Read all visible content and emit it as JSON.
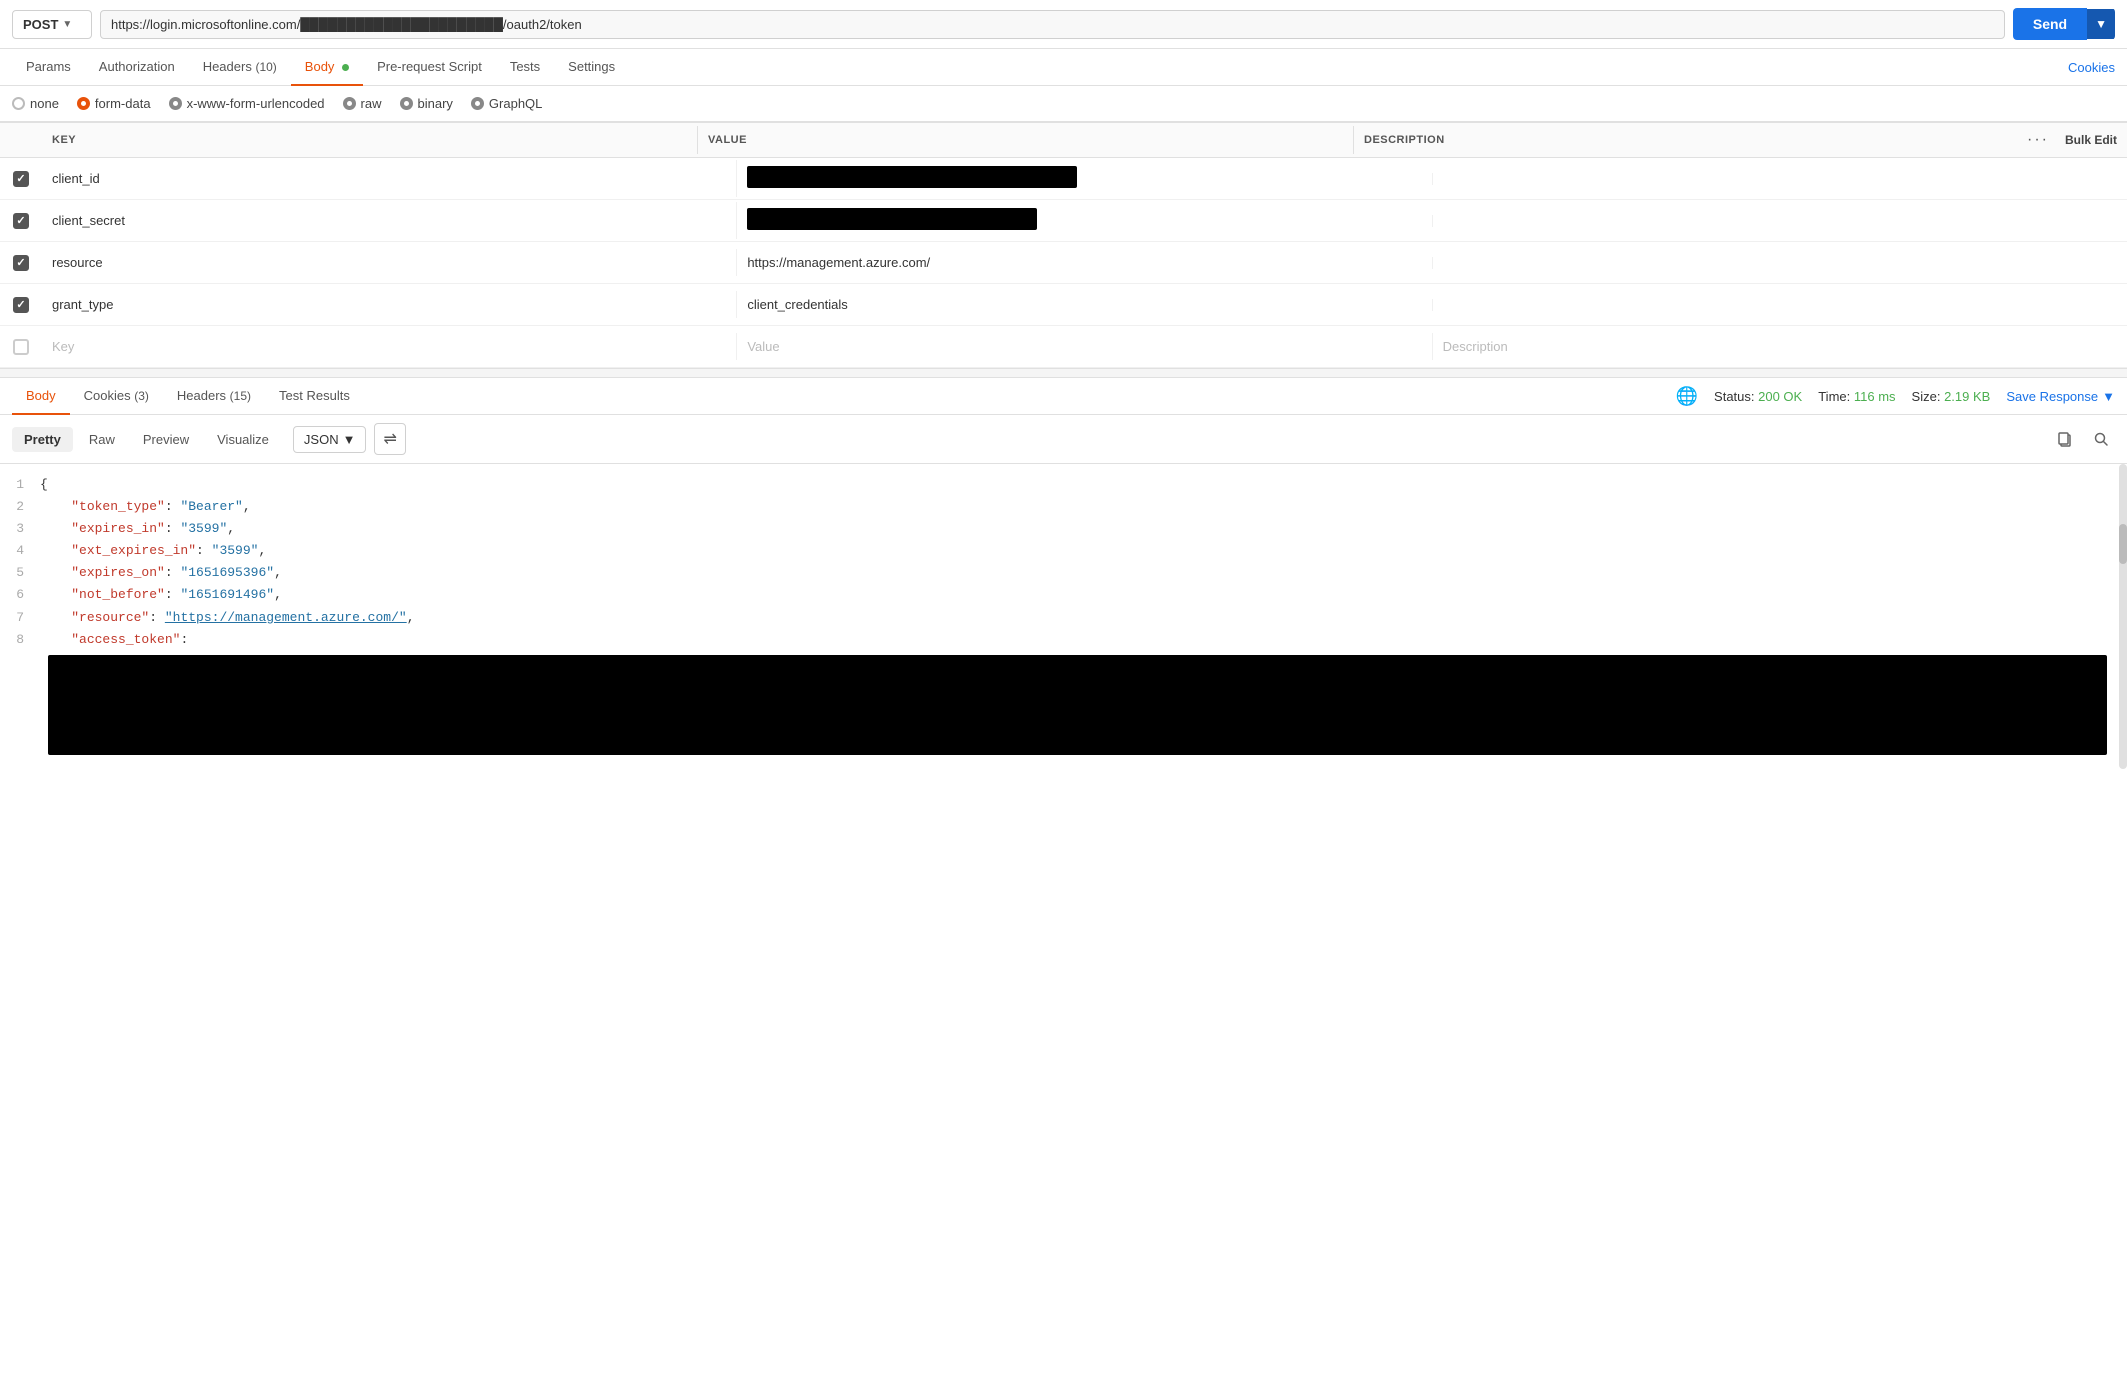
{
  "urlBar": {
    "method": "POST",
    "url": "https://login.microsoftonline.com/████████████████████████████/oauth2/token",
    "urlDisplay": "https://login.microsoftonline.com/",
    "urlRedacted": "██████████████████████████",
    "urlSuffix": "/oauth2/token",
    "sendLabel": "Send"
  },
  "tabs": {
    "items": [
      {
        "label": "Params",
        "active": false,
        "badge": null,
        "dot": false
      },
      {
        "label": "Authorization",
        "active": false,
        "badge": null,
        "dot": false
      },
      {
        "label": "Headers",
        "active": false,
        "badge": "(10)",
        "dot": false
      },
      {
        "label": "Body",
        "active": true,
        "badge": null,
        "dot": true
      },
      {
        "label": "Pre-request Script",
        "active": false,
        "badge": null,
        "dot": false
      },
      {
        "label": "Tests",
        "active": false,
        "badge": null,
        "dot": false
      },
      {
        "label": "Settings",
        "active": false,
        "badge": null,
        "dot": false
      }
    ],
    "rightLink": "Cookies"
  },
  "bodyTypes": [
    {
      "id": "none",
      "label": "none",
      "selected": false
    },
    {
      "id": "form-data",
      "label": "form-data",
      "selected": true
    },
    {
      "id": "x-www-form-urlencoded",
      "label": "x-www-form-urlencoded",
      "selected": false
    },
    {
      "id": "raw",
      "label": "raw",
      "selected": false
    },
    {
      "id": "binary",
      "label": "binary",
      "selected": false
    },
    {
      "id": "graphql",
      "label": "GraphQL",
      "selected": false
    }
  ],
  "tableHeaders": {
    "key": "KEY",
    "value": "VALUE",
    "description": "DESCRIPTION",
    "bulkEdit": "Bulk Edit"
  },
  "tableRows": [
    {
      "key": "client_id",
      "value": "REDACTED_LONG",
      "description": "",
      "checked": true
    },
    {
      "key": "client_secret",
      "value": "REDACTED_MEDIUM",
      "description": "",
      "checked": true
    },
    {
      "key": "resource",
      "value": "https://management.azure.com/",
      "description": "",
      "checked": true
    },
    {
      "key": "grant_type",
      "value": "client_credentials",
      "description": "",
      "checked": true
    },
    {
      "key": "",
      "value": "",
      "description": "",
      "checked": false,
      "placeholder": true
    }
  ],
  "responseTabs": {
    "items": [
      {
        "label": "Body",
        "active": true
      },
      {
        "label": "Cookies",
        "badge": "(3)",
        "active": false
      },
      {
        "label": "Headers",
        "badge": "(15)",
        "active": false
      },
      {
        "label": "Test Results",
        "active": false
      }
    ],
    "status": {
      "label": "Status:",
      "code": "200 OK",
      "timeLabel": "Time:",
      "time": "116 ms",
      "sizeLabel": "Size:",
      "size": "2.19 KB"
    },
    "saveResponse": "Save Response"
  },
  "formatBar": {
    "tabs": [
      {
        "label": "Pretty",
        "active": true
      },
      {
        "label": "Raw",
        "active": false
      },
      {
        "label": "Preview",
        "active": false
      },
      {
        "label": "Visualize",
        "active": false
      }
    ],
    "format": "JSON"
  },
  "jsonLines": [
    {
      "num": 1,
      "type": "brace",
      "content": "{"
    },
    {
      "num": 2,
      "type": "kv",
      "key": "\"token_type\"",
      "colon": ": ",
      "value": "\"Bearer\"",
      "comma": ","
    },
    {
      "num": 3,
      "type": "kv",
      "key": "\"expires_in\"",
      "colon": ": ",
      "value": "\"3599\"",
      "comma": ","
    },
    {
      "num": 4,
      "type": "kv",
      "key": "\"ext_expires_in\"",
      "colon": ": ",
      "value": "\"3599\"",
      "comma": ","
    },
    {
      "num": 5,
      "type": "kv",
      "key": "\"expires_on\"",
      "colon": ": ",
      "value": "\"1651695396\"",
      "comma": ","
    },
    {
      "num": 6,
      "type": "kv",
      "key": "\"not_before\"",
      "colon": ": ",
      "value": "\"1651691496\"",
      "comma": ","
    },
    {
      "num": 7,
      "type": "kv-link",
      "key": "\"resource\"",
      "colon": ": ",
      "value": "\"https://management.azure.com/\"",
      "comma": ","
    },
    {
      "num": 8,
      "type": "kv-plain",
      "key": "\"access_token\"",
      "colon": ": ",
      "value": "",
      "comma": ""
    }
  ]
}
